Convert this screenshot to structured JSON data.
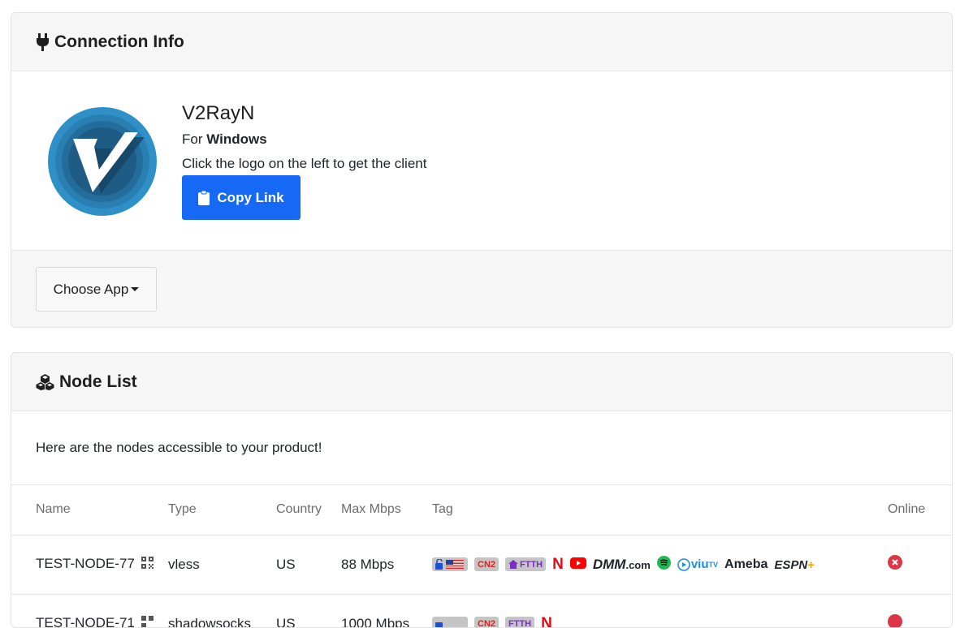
{
  "connection": {
    "title": "Connection Info",
    "app_name": "V2RayN",
    "platform_prefix": "For",
    "platform": "Windows",
    "hint": "Click the logo on the left to get the client",
    "copy_label": "Copy Link",
    "choose_label": "Choose App"
  },
  "nodes": {
    "title": "Node List",
    "intro": "Here are the nodes accessible to your product!",
    "columns": [
      "Name",
      "Type",
      "Country",
      "Max Mbps",
      "Tag",
      "Online"
    ],
    "rows": [
      {
        "name": "TEST-NODE-77",
        "type": "vless",
        "country": "US",
        "mbps": "88 Mbps",
        "online": false
      },
      {
        "name": "TEST-NODE-71",
        "type": "shadowsocks",
        "country": "US",
        "mbps": "1000 Mbps",
        "online": false
      }
    ],
    "tags": {
      "cn2": "CN2",
      "ftth": "FTTH",
      "netflix": "N",
      "dmm": "DMM",
      "dmm_suffix": ".com",
      "viu": "viu",
      "viu_suffix": "TV",
      "ameba": "Ameba",
      "espn": "ESPN",
      "espn_suffix": "+"
    }
  },
  "colors": {
    "primary": "#1669f4",
    "danger": "#dc3545",
    "logo_blue": "#2f90c8"
  }
}
